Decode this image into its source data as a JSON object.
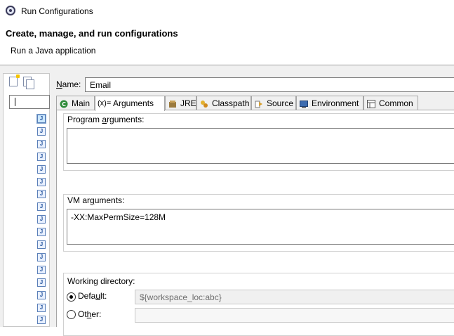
{
  "window": {
    "title": "Run Configurations"
  },
  "header": {
    "heading": "Create, manage, and run configurations",
    "subtitle": "Run a Java application"
  },
  "left_pane": {
    "toolbar": [
      {
        "name": "new-launch-configuration-icon"
      },
      {
        "name": "duplicate-configuration-icon"
      }
    ],
    "filter_value": "",
    "tree_item_icon": "java-application-icon",
    "tree_item_glyph": "J"
  },
  "config": {
    "name_label": "Name:",
    "name_value": "Email"
  },
  "tabs": [
    {
      "label": "Main",
      "icon": "main-tab-icon",
      "active": false
    },
    {
      "label": "Arguments",
      "icon": "arguments-tab-icon",
      "icon_glyph": "(x)=",
      "active": true
    },
    {
      "label": "JRE",
      "icon": "jre-tab-icon",
      "active": false
    },
    {
      "label": "Classpath",
      "icon": "classpath-tab-icon",
      "active": false
    },
    {
      "label": "Source",
      "icon": "source-tab-icon",
      "active": false
    },
    {
      "label": "Environment",
      "icon": "environment-tab-icon",
      "active": false
    },
    {
      "label": "Common",
      "icon": "common-tab-icon",
      "active": false
    }
  ],
  "arguments": {
    "program_args_label": "Program arguments:",
    "program_args_value": "",
    "vm_args_label": "VM arguments:",
    "vm_args_value": "-XX:MaxPermSize=128M",
    "working_dir": {
      "label": "Working directory:",
      "default_label": "Default:",
      "default_value": "${workspace_loc:abc}",
      "default_selected": true,
      "other_label": "Other:",
      "other_value": ""
    }
  }
}
